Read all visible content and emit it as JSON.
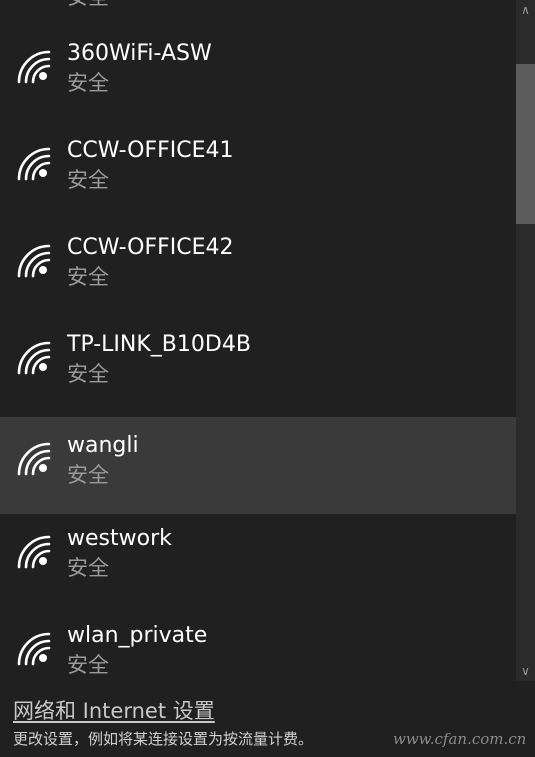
{
  "networks": [
    {
      "name": "360WiFi-ASW",
      "status": "安全"
    },
    {
      "name": "CCW-OFFICE41",
      "status": "安全"
    },
    {
      "name": "CCW-OFFICE42",
      "status": "安全"
    },
    {
      "name": "TP-LINK_B10D4B",
      "status": "安全"
    },
    {
      "name": "wangli",
      "status": "安全",
      "selected": true
    },
    {
      "name": "westwork",
      "status": "安全"
    },
    {
      "name": "wlan_private",
      "status": "安全"
    }
  ],
  "clipped_status": "安全",
  "footer": {
    "settings_link": "网络和 Internet 设置",
    "hint": "更改设置，例如将某连接设置为按流量计费。"
  },
  "watermark": "www.cfan.com.cn",
  "colors": {
    "background": "#202020",
    "selected_row": "#3a3a3a",
    "secondary_text": "#9a9a9a"
  }
}
